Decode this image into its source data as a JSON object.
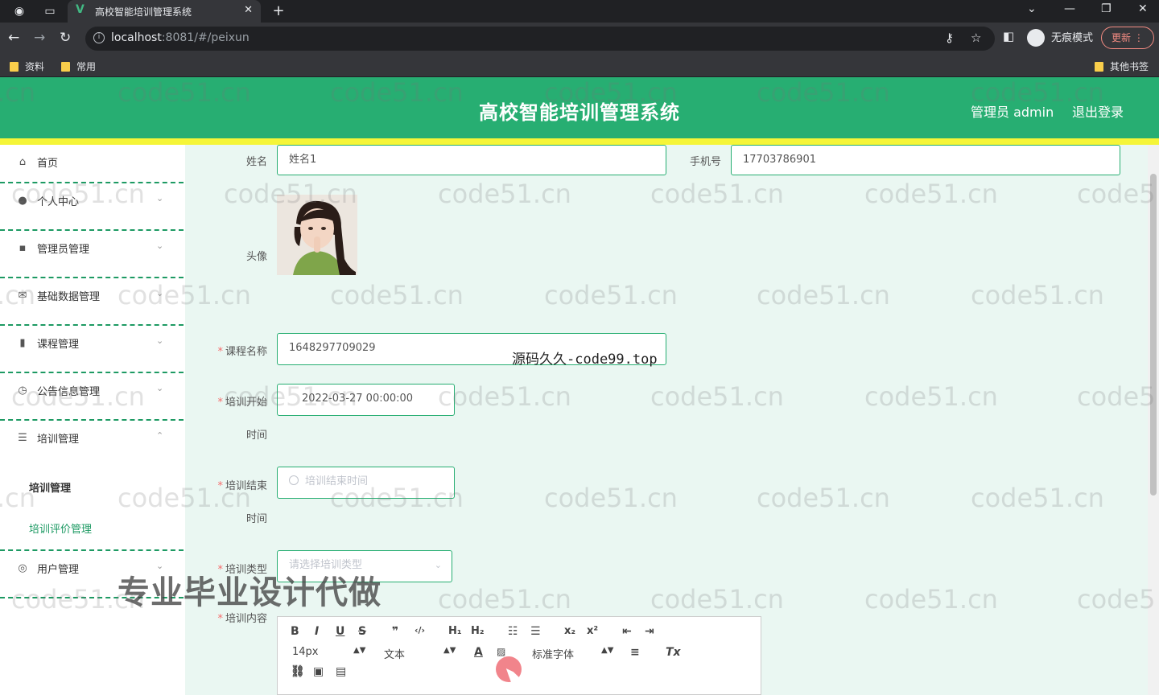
{
  "browser": {
    "tab_title": "高校智能培训管理系统",
    "tab_close": "✕",
    "new_tab": "+",
    "url_host": "localhost",
    "url_rest": ":8081/#/peixun",
    "profile_label": "无痕模式",
    "update_label": "更新",
    "bookmarks": [
      "资料",
      "常用"
    ],
    "other_bookmarks": "其他书签"
  },
  "header": {
    "title": "高校智能培训管理系统",
    "user": "管理员 admin",
    "logout": "退出登录"
  },
  "sidebar": {
    "items": [
      {
        "label": "首页",
        "icon": "home-icon"
      },
      {
        "label": "个人中心",
        "icon": "user-icon"
      },
      {
        "label": "管理员管理",
        "icon": "admin-icon"
      },
      {
        "label": "基础数据管理",
        "icon": "mail-icon"
      },
      {
        "label": "课程管理",
        "icon": "chart-icon"
      },
      {
        "label": "公告信息管理",
        "icon": "clock-icon"
      },
      {
        "label": "培训管理",
        "icon": "list-icon"
      },
      {
        "label": "用户管理",
        "icon": "user-circle-icon"
      }
    ],
    "sub_items": [
      "培训管理",
      "培训评价管理"
    ]
  },
  "form": {
    "name_label": "姓名",
    "name_value": "姓名1",
    "phone_label": "手机号",
    "phone_value": "17703786901",
    "avatar_label": "头像",
    "course_label": "课程名称",
    "course_value": "1648297709029",
    "start_label_1": "培训开始",
    "start_label_2": "时间",
    "start_value": "2022-03-27 00:00:00",
    "end_label_1": "培训结束",
    "end_label_2": "时间",
    "end_placeholder": "培训结束时间",
    "type_label": "培训类型",
    "type_placeholder": "请选择培训类型",
    "content_label": "培训内容",
    "required_mark": "*"
  },
  "editor": {
    "font_size": "14px",
    "paragraph": "文本",
    "font_family": "标准字体"
  },
  "watermarks": {
    "site": "code51.cn",
    "site_partial_left": ".cn",
    "site_partial_right": "code5",
    "promo": "专业毕业设计代做",
    "code99": "源码久久-code99.top"
  }
}
